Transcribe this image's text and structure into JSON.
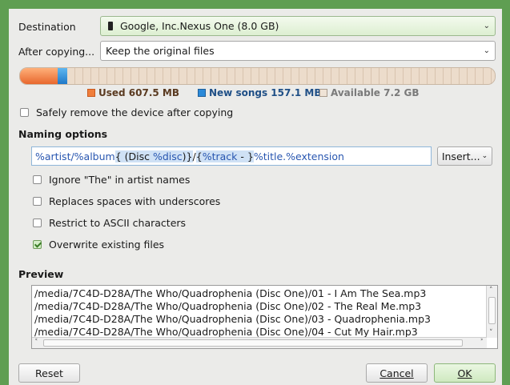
{
  "destination": {
    "label": "Destination",
    "value": "Google, Inc.Nexus One (8.0 GB)"
  },
  "after_copying": {
    "label": "After copying...",
    "value": "Keep the original files"
  },
  "capacity": {
    "used_fraction": 0.079,
    "new_fraction": 0.02,
    "used_label": "Used 607.5 MB",
    "new_label": "New songs 157.1 MB",
    "available_label": "Available 7.2 GB",
    "colors": {
      "used": "#f07e3b",
      "new": "#2b8ad9",
      "available": "#e8d7c6"
    }
  },
  "safely_remove": {
    "label": "Safely remove the device after copying",
    "checked": false
  },
  "naming": {
    "title": "Naming options",
    "pattern": {
      "p1": "%artist/%album",
      "p2": "{ (Disc ",
      "p3": "%disc",
      "p4": ")}",
      "p5": "/",
      "p6": "{",
      "p7": "%track",
      "p8": " - }",
      "p9": "%title.%extension"
    },
    "insert_label": "Insert...",
    "options": [
      {
        "label": "Ignore \"The\" in artist names",
        "checked": false
      },
      {
        "label": "Replaces spaces with underscores",
        "checked": false
      },
      {
        "label": "Restrict to ASCII characters",
        "checked": false
      },
      {
        "label": "Overwrite existing files",
        "checked": true
      }
    ]
  },
  "preview": {
    "title": "Preview",
    "lines": [
      "/media/7C4D-D28A/The Who/Quadrophenia (Disc One)/01 - I Am The Sea.mp3",
      "/media/7C4D-D28A/The Who/Quadrophenia (Disc One)/02 - The Real Me.mp3",
      "/media/7C4D-D28A/The Who/Quadrophenia (Disc One)/03 - Quadrophenia.mp3",
      "/media/7C4D-D28A/The Who/Quadrophenia (Disc One)/04 - Cut My Hair.mp3"
    ]
  },
  "buttons": {
    "reset": "Reset",
    "cancel": "Cancel",
    "ok": "OK"
  },
  "icons": {
    "device": "phone-icon",
    "dropdown": "chevron-down-icon"
  }
}
